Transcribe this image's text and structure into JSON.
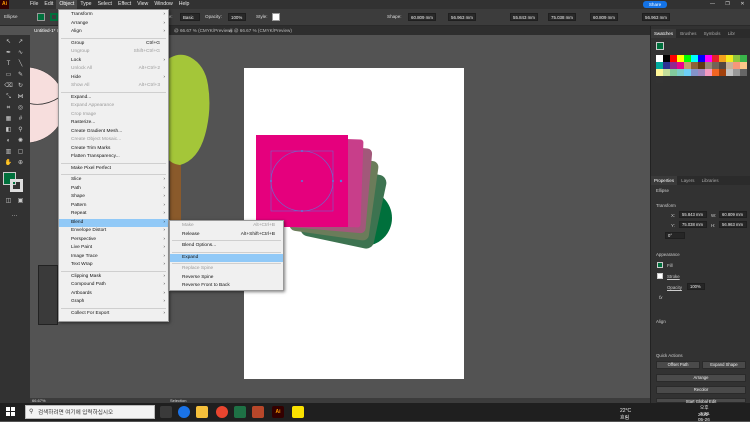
{
  "app": {
    "icon_label": "Ai"
  },
  "menubar": {
    "items": [
      "File",
      "Edit",
      "Object",
      "Type",
      "Select",
      "Effect",
      "View",
      "Window",
      "Help"
    ],
    "active": "Object",
    "share_label": "Share"
  },
  "window_controls": [
    "—",
    "❐",
    "✕"
  ],
  "controlbar": {
    "selection_label": "Ellipse",
    "stroke_label": "Stroke:",
    "basic_label": "Basic",
    "opacity_label": "Opacity:",
    "opacity_value": "100%",
    "style_label": "Style:",
    "shape_label": "Shape:",
    "w_value": "60.809 mm",
    "h_value": "56.963 mm",
    "x_value": "55.843 mm",
    "y_value": "75.038 mm",
    "w2_value": "60.809 mm",
    "h2_value": "56.963 mm"
  },
  "tabs": [
    {
      "label": "Untitled-1* @ 66.67 % (CMYK/Preview)"
    },
    {
      "label": "@ 66.67 % (CMYK/Preview)"
    },
    {
      "label": "ai @ 66.67 % (CMYK/Preview)"
    }
  ],
  "status": {
    "zoom": "66.67%",
    "tool": "Selection"
  },
  "object_menu": {
    "items": [
      {
        "label": "Transform",
        "arrow": true
      },
      {
        "label": "Arrange",
        "arrow": true
      },
      {
        "label": "Align",
        "arrow": true
      },
      {
        "sep": true
      },
      {
        "label": "Group",
        "shortcut": "Ctrl+G"
      },
      {
        "label": "Ungroup",
        "shortcut": "Shift+Ctrl+G",
        "disabled": true
      },
      {
        "label": "Lock",
        "arrow": true
      },
      {
        "label": "Unlock All",
        "shortcut": "Alt+Ctrl+2",
        "disabled": true
      },
      {
        "label": "Hide",
        "arrow": true
      },
      {
        "label": "Show All",
        "shortcut": "Alt+Ctrl+3",
        "disabled": true
      },
      {
        "sep": true
      },
      {
        "label": "Expand..."
      },
      {
        "label": "Expand Appearance",
        "disabled": true
      },
      {
        "label": "Crop Image",
        "disabled": true
      },
      {
        "label": "Rasterize..."
      },
      {
        "label": "Create Gradient Mesh..."
      },
      {
        "label": "Create Object Mosaic...",
        "disabled": true
      },
      {
        "label": "Create Trim Marks"
      },
      {
        "label": "Flatten Transparency..."
      },
      {
        "sep": true
      },
      {
        "label": "Make Pixel Perfect"
      },
      {
        "sep": true
      },
      {
        "label": "Slice",
        "arrow": true
      },
      {
        "label": "Path",
        "arrow": true
      },
      {
        "label": "Shape",
        "arrow": true
      },
      {
        "label": "Pattern",
        "arrow": true
      },
      {
        "label": "Repeat",
        "arrow": true
      },
      {
        "label": "Blend",
        "arrow": true,
        "highlight": true
      },
      {
        "label": "Envelope Distort",
        "arrow": true
      },
      {
        "label": "Perspective",
        "arrow": true
      },
      {
        "label": "Live Paint",
        "arrow": true
      },
      {
        "label": "Image Trace",
        "arrow": true
      },
      {
        "label": "Text Wrap",
        "arrow": true
      },
      {
        "sep": true
      },
      {
        "label": "Clipping Mask",
        "arrow": true
      },
      {
        "label": "Compound Path",
        "arrow": true
      },
      {
        "label": "Artboards",
        "arrow": true
      },
      {
        "label": "Graph",
        "arrow": true
      },
      {
        "sep": true
      },
      {
        "label": "Collect For Export",
        "arrow": true
      }
    ]
  },
  "blend_menu": {
    "items": [
      {
        "label": "Make",
        "shortcut": "Alt+Ctrl+B",
        "disabled": true
      },
      {
        "label": "Release",
        "shortcut": "Alt+Shift+Ctrl+B"
      },
      {
        "sep": true
      },
      {
        "label": "Blend Options..."
      },
      {
        "sep": true
      },
      {
        "label": "Expand",
        "highlight": true
      },
      {
        "sep": true
      },
      {
        "label": "Replace Spine",
        "disabled": true
      },
      {
        "label": "Reverse Spine"
      },
      {
        "label": "Reverse Front to Back"
      }
    ]
  },
  "right_panel": {
    "top_tabs": [
      "Swatches",
      "Brushes",
      "Symbols",
      "Libr"
    ],
    "prop_tabs": [
      "Properties",
      "Layers",
      "Libraries"
    ],
    "ellipse_label": "Ellipse",
    "transform_label": "Transform",
    "x_label": "X:",
    "x_value": "55.843 mm",
    "y_label": "Y:",
    "y_value": "75.038 mm",
    "w_label": "W:",
    "w_value": "60.809 mm",
    "h_label": "H:",
    "h_value": "56.963 mm",
    "angle_value": "0°",
    "appearance_label": "Appearance",
    "fill_label": "Fill",
    "stroke_label": "Stroke",
    "opacity_label": "Opacity",
    "opacity_value": "100%",
    "align_label": "Align",
    "quick_actions_label": "Quick Actions",
    "offset_path": "Offset Path",
    "expand_shape": "Expand Shape",
    "arrange": "Arrange",
    "recolor": "Recolor",
    "start_global_edit": "Start Global Edit"
  },
  "swatch_colors": [
    "#ffffff",
    "#000000",
    "#ff0000",
    "#ffff00",
    "#00ff00",
    "#00ffff",
    "#0000ff",
    "#ff00ff",
    "#e8202a",
    "#f3a11c",
    "#f6ea1c",
    "#8dc63f",
    "#39b54a",
    "#00a99d",
    "#2e3192",
    "#92278f",
    "#ec008c",
    "#c69c6d",
    "#8c6239",
    "#603813",
    "#998675",
    "#736357",
    "#534741",
    "#c7b299",
    "#f7977a",
    "#fdc689",
    "#fff799",
    "#c4df9b",
    "#82ca9c",
    "#7accc8",
    "#6dcff6",
    "#8393ca",
    "#a186be",
    "#f49ac1",
    "#f26522",
    "#a0410d",
    "#c2c2c2",
    "#999999",
    "#666666",
    "#333333"
  ],
  "taskbar": {
    "search_placeholder": "검색하려면 여기에 입력하십시오",
    "weather": "22°C 흐림",
    "time": "오후 3:30",
    "date": "2022-05-26"
  }
}
